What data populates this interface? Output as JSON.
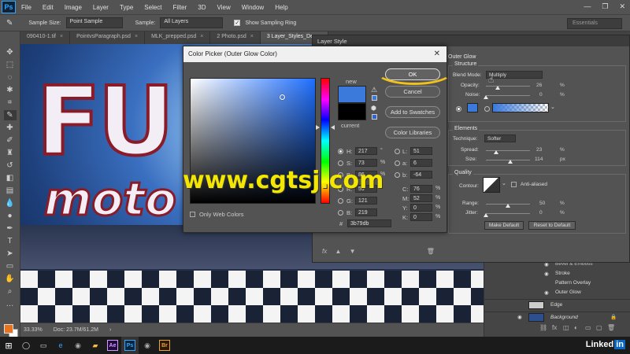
{
  "app": {
    "logo": "Ps",
    "menu": [
      "File",
      "Edit",
      "Image",
      "Layer",
      "Type",
      "Select",
      "Filter",
      "3D",
      "View",
      "Window",
      "Help"
    ],
    "window_controls": [
      "—",
      "❐",
      "✕"
    ]
  },
  "options_bar": {
    "sample_size_label": "Sample Size:",
    "sample_size_value": "Point Sample",
    "sample_label": "Sample:",
    "sample_value": "All Layers",
    "show_ring_label": "Show Sampling Ring",
    "show_ring_checked": true,
    "workspace": "Essentials"
  },
  "tabs": [
    {
      "label": "090410-1.tif",
      "active": false
    },
    {
      "label": "PointvsParagraph.psd",
      "active": false
    },
    {
      "label": "MLK_prepped.psd",
      "active": false
    },
    {
      "label": "2 Photo.psd",
      "active": false
    },
    {
      "label": "3 Layer_Styles_Demo",
      "active": true
    }
  ],
  "canvas": {
    "text_big": "FU",
    "text_moto": "moto"
  },
  "status_bar": {
    "zoom": "33.33%",
    "doc": "Doc: 23.7M/61.2M"
  },
  "layer_style": {
    "title": "Layer Style",
    "outer_glow": "Outer Glow",
    "structure": "Structure",
    "blend_mode_label": "Blend Mode:",
    "blend_mode_value": "Multiply",
    "opacity_label": "Opacity:",
    "opacity_value": "26",
    "noise_label": "Noise:",
    "noise_value": "0",
    "elements": "Elements",
    "technique_label": "Technique:",
    "technique_value": "Softer",
    "spread_label": "Spread:",
    "spread_value": "23",
    "size_label": "Size:",
    "size_value": "114",
    "size_unit": "px",
    "quality": "Quality",
    "contour_label": "Contour:",
    "anti_aliased": "Anti-aliased",
    "range_label": "Range:",
    "range_value": "50",
    "jitter_label": "Jitter:",
    "jitter_value": "0",
    "make_default": "Make Default",
    "reset_default": "Reset to Default",
    "percent": "%"
  },
  "layers_panel": {
    "rows": [
      "Bevel & Emboss",
      "Stroke",
      "Pattern Overlay",
      "Outer Glow",
      "Edge",
      "Background"
    ]
  },
  "color_picker": {
    "title": "Color Picker (Outer Glow Color)",
    "new_label": "new",
    "current_label": "current",
    "ok": "OK",
    "cancel": "Cancel",
    "add_swatches": "Add to Swatches",
    "color_libraries": "Color Libraries",
    "only_web": "Only Web Colors",
    "hsb": {
      "H": "217",
      "S": "73",
      "B": "86"
    },
    "hsb_units": {
      "H": "°",
      "S": "%",
      "B": "%"
    },
    "rgb": {
      "R": "59",
      "G": "121",
      "B": "219"
    },
    "lab": {
      "L": "51",
      "a": "6",
      "b": "-64"
    },
    "cmyk": {
      "C": "76",
      "M": "52",
      "Y": "0",
      "K": "0"
    },
    "cmyk_unit": "%",
    "hex": "3b79db",
    "hex_prefix": "#",
    "new_color": "#3b79db",
    "current_color": "#000000"
  },
  "watermark": "www.cgtsj.com",
  "brand": {
    "text": "Linked",
    "badge": "in"
  },
  "colors": {
    "accent_yellow": "#f2c21b",
    "glow_color": "#3b79db",
    "foreground": "#e8731f"
  }
}
